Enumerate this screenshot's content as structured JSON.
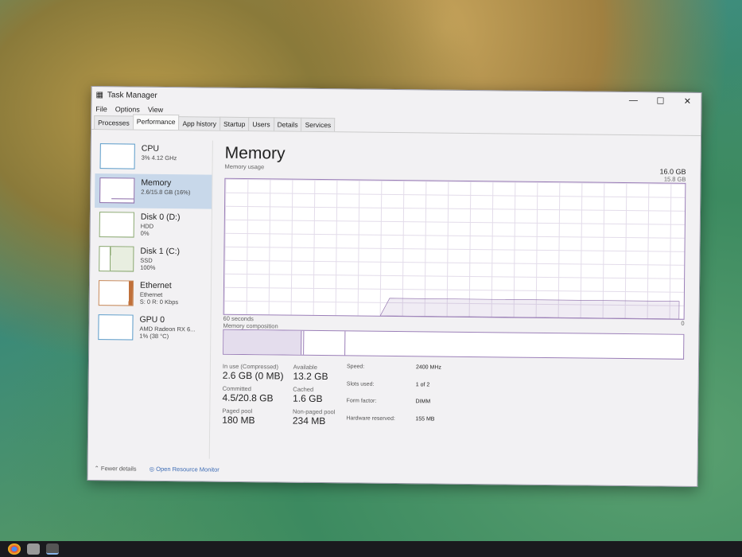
{
  "window": {
    "title": "Task Manager",
    "minimize": "—",
    "maximize": "☐",
    "close": "✕"
  },
  "menu": [
    "File",
    "Options",
    "View"
  ],
  "tabs": [
    "Processes",
    "Performance",
    "App history",
    "Startup",
    "Users",
    "Details",
    "Services"
  ],
  "sidebar": [
    {
      "name": "CPU",
      "line1": "3% 4.12 GHz",
      "line2": ""
    },
    {
      "name": "Memory",
      "line1": "2.6/15.8 GB (16%)",
      "line2": ""
    },
    {
      "name": "Disk 0 (D:)",
      "line1": "HDD",
      "line2": "0%"
    },
    {
      "name": "Disk 1 (C:)",
      "line1": "SSD",
      "line2": "100%"
    },
    {
      "name": "Ethernet",
      "line1": "Ethernet",
      "line2": "S: 0 R: 0 Kbps"
    },
    {
      "name": "GPU 0",
      "line1": "AMD Radeon RX 6...",
      "line2": "1% (38 °C)"
    }
  ],
  "main": {
    "title": "Memory",
    "total": "16.0 GB",
    "usage_label": "Memory usage",
    "graph_max": "15.8 GB",
    "time_label": "60 seconds",
    "zero": "0",
    "composition_label": "Memory composition",
    "usage_percent": 16
  },
  "stats": {
    "in_use_label": "In use (Compressed)",
    "in_use": "2.6 GB (0 MB)",
    "available_label": "Available",
    "available": "13.2 GB",
    "committed_label": "Committed",
    "committed": "4.5/20.8 GB",
    "cached_label": "Cached",
    "cached": "1.6 GB",
    "paged_label": "Paged pool",
    "paged": "180 MB",
    "nonpaged_label": "Non-paged pool",
    "nonpaged": "234 MB"
  },
  "hw": [
    [
      "Speed:",
      "2400 MHz"
    ],
    [
      "Slots used:",
      "1 of 2"
    ],
    [
      "Form factor:",
      "DIMM"
    ],
    [
      "Hardware reserved:",
      "155 MB"
    ]
  ],
  "footer": {
    "fewer": "Fewer details",
    "monitor": "Open Resource Monitor"
  }
}
